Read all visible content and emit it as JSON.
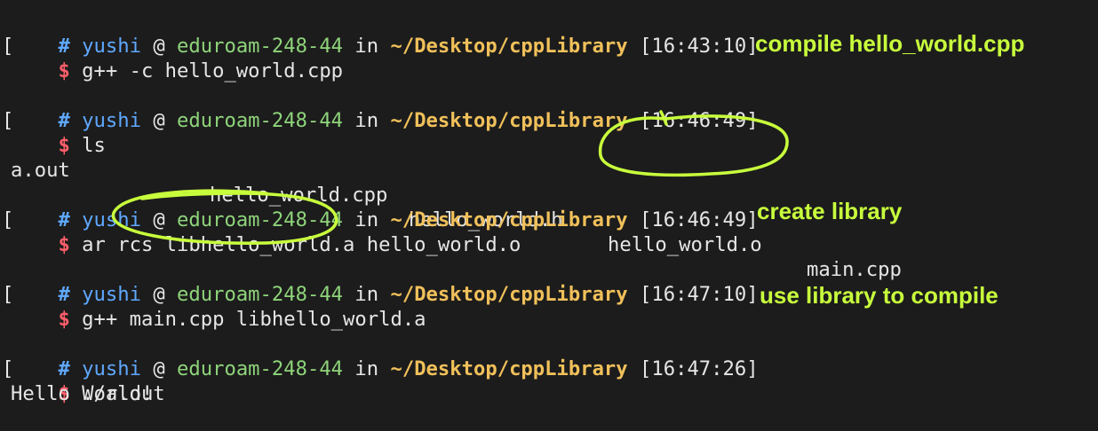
{
  "prompt": {
    "hash": "#",
    "user": "yushi",
    "at": "@",
    "host": "eduroam-248-44",
    "in": "in",
    "path": "~/Desktop/cppLibrary",
    "bracket": "[",
    "dollar": "$"
  },
  "blocks": [
    {
      "time": "[16:43:10]",
      "command": "g++ -c hello_world.cpp"
    },
    {
      "time": "[16:46:49]",
      "command": "ls",
      "output": {
        "executable": "a.out",
        "files": [
          "hello_world.cpp",
          "hello_world.h",
          "hello_world.o",
          "main.cpp"
        ]
      }
    },
    {
      "time": "[16:46:49]",
      "command": "ar rcs libhello_world.a hello_world.o"
    },
    {
      "time": "[16:47:10]",
      "command": "g++ main.cpp libhello_world.a"
    },
    {
      "time": "[16:47:26]",
      "command": "./a.out",
      "output_text": "Hello World!"
    }
  ],
  "annotations": {
    "compile": "compile hello_world.cpp",
    "create": "create library",
    "use": "use library to compile"
  },
  "colors": {
    "background": "#1c1c1c",
    "user": "#5fa8ff",
    "host": "#8ed47a",
    "path": "#f0c05a",
    "dollar": "#ff5f6b",
    "annotation": "#c8ff3c"
  }
}
